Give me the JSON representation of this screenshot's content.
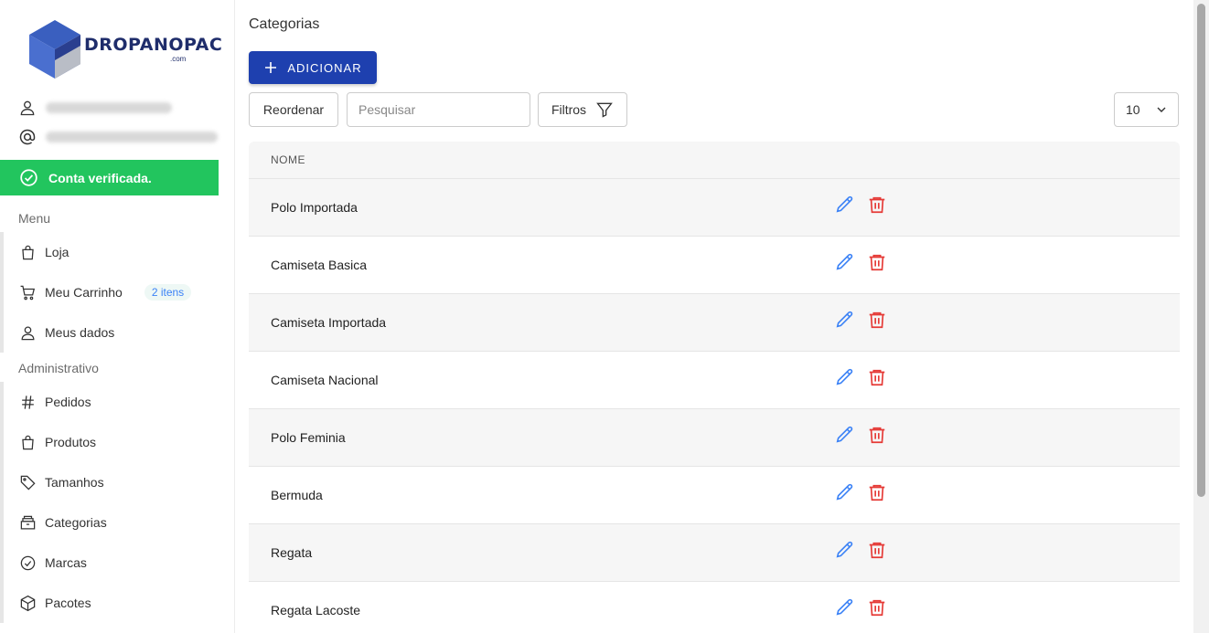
{
  "brand": {
    "name": "DROPANOPAC",
    "suffix": ".com"
  },
  "user": {
    "verified_label": "Conta verificada."
  },
  "menu": {
    "label": "Menu",
    "items": [
      {
        "label": "Loja",
        "icon": "shopping-bag-icon"
      },
      {
        "label": "Meu Carrinho",
        "icon": "cart-icon",
        "badge": "2 itens"
      },
      {
        "label": "Meus dados",
        "icon": "user-icon"
      }
    ]
  },
  "admin": {
    "label": "Administrativo",
    "items": [
      {
        "label": "Pedidos",
        "icon": "hash-icon"
      },
      {
        "label": "Produtos",
        "icon": "shopping-bag-icon"
      },
      {
        "label": "Tamanhos",
        "icon": "tag-icon"
      },
      {
        "label": "Categorias",
        "icon": "archive-icon"
      },
      {
        "label": "Marcas",
        "icon": "check-circle-icon"
      },
      {
        "label": "Pacotes",
        "icon": "package-icon"
      }
    ]
  },
  "page": {
    "title": "Categorias",
    "add_label": "ADICIONAR",
    "reorder_label": "Reordenar",
    "search_placeholder": "Pesquisar",
    "filters_label": "Filtros",
    "per_page": "10"
  },
  "table": {
    "header": "NOME",
    "rows": [
      "Polo Importada",
      "Camiseta Basica",
      "Camiseta Importada",
      "Camiseta Nacional",
      "Polo Feminia",
      "Bermuda",
      "Regata",
      "Regata Lacoste"
    ]
  },
  "colors": {
    "primary": "#1e40af",
    "success": "#22c55e",
    "edit": "#3b82f6",
    "delete": "#e53935"
  }
}
